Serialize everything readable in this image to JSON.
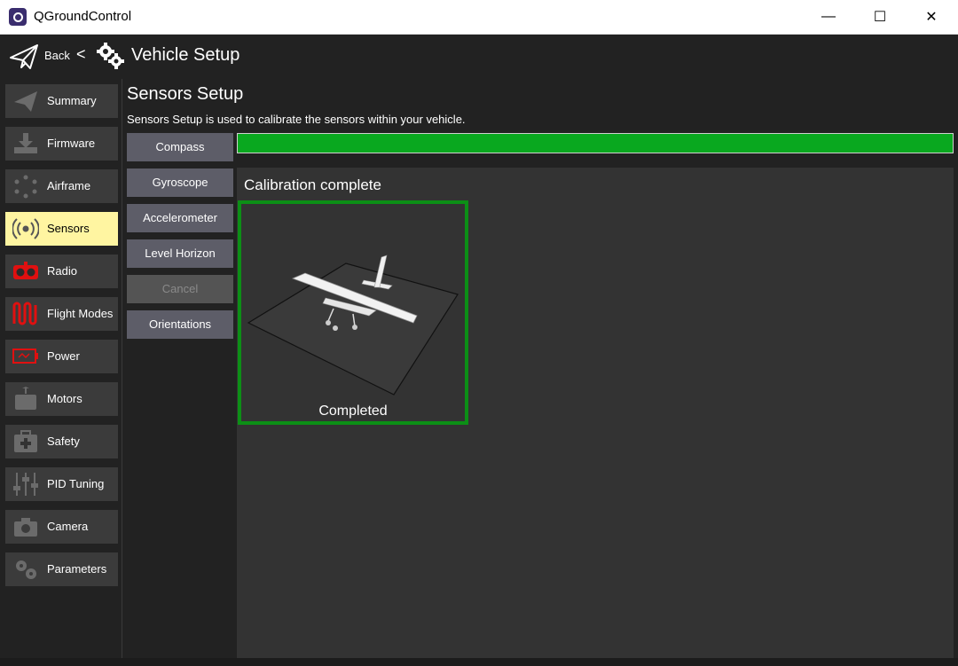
{
  "window": {
    "title": "QGroundControl",
    "minimize": "—",
    "maximize": "☐",
    "close": "✕"
  },
  "header": {
    "back_label": "Back",
    "separator": "<",
    "title": "Vehicle Setup"
  },
  "sidebar": {
    "items": [
      {
        "label": "Summary",
        "icon": "paper-plane-icon",
        "active": false
      },
      {
        "label": "Firmware",
        "icon": "download-icon",
        "active": false
      },
      {
        "label": "Airframe",
        "icon": "airframe-icon",
        "active": false
      },
      {
        "label": "Sensors",
        "icon": "sensors-icon",
        "active": true
      },
      {
        "label": "Radio",
        "icon": "radio-icon",
        "active": false
      },
      {
        "label": "Flight Modes",
        "icon": "flight-modes-icon",
        "active": false
      },
      {
        "label": "Power",
        "icon": "battery-icon",
        "active": false
      },
      {
        "label": "Motors",
        "icon": "motor-icon",
        "active": false
      },
      {
        "label": "Safety",
        "icon": "first-aid-icon",
        "active": false
      },
      {
        "label": "PID Tuning",
        "icon": "sliders-icon",
        "active": false
      },
      {
        "label": "Camera",
        "icon": "camera-icon",
        "active": false
      },
      {
        "label": "Parameters",
        "icon": "gears-icon",
        "active": false
      }
    ]
  },
  "main": {
    "title": "Sensors Setup",
    "subtitle": "Sensors Setup is used to calibrate the sensors within your vehicle.",
    "buttons": [
      {
        "label": "Compass",
        "enabled": true
      },
      {
        "label": "Gyroscope",
        "enabled": true
      },
      {
        "label": "Accelerometer",
        "enabled": true
      },
      {
        "label": "Level Horizon",
        "enabled": true
      },
      {
        "label": "Cancel",
        "enabled": false
      },
      {
        "label": "Orientations",
        "enabled": true
      }
    ],
    "progress": 1.0,
    "status_title": "Calibration complete",
    "orientation_status": "Completed"
  },
  "colors": {
    "accent_active": "#fff5a1",
    "progress": "#09a81f",
    "complete_border": "#0c8f16",
    "button": "#5d5d68"
  }
}
